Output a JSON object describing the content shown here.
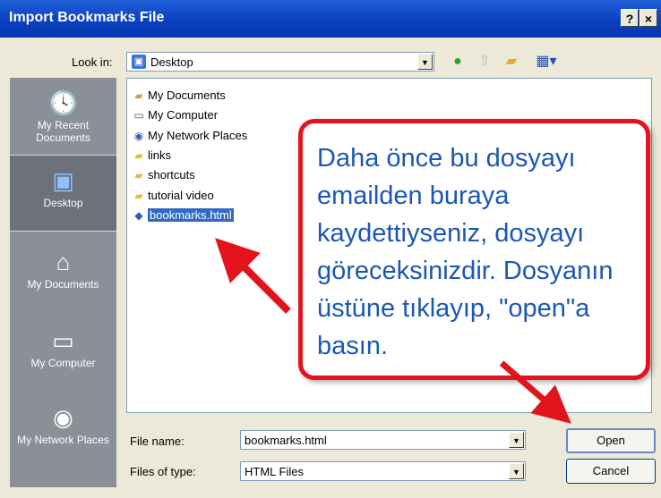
{
  "window": {
    "title": "Import Bookmarks File",
    "help_label": "?",
    "close_label": "×"
  },
  "lookin": {
    "label": "Look in:",
    "value": "Desktop"
  },
  "places": [
    {
      "label": "My Recent Documents",
      "icon": "recent-documents-icon"
    },
    {
      "label": "Desktop",
      "icon": "desktop-icon"
    },
    {
      "label": "My Documents",
      "icon": "my-documents-icon"
    },
    {
      "label": "My Computer",
      "icon": "my-computer-icon"
    },
    {
      "label": "My Network Places",
      "icon": "network-places-icon"
    }
  ],
  "files": [
    {
      "name": "My Documents",
      "icon": "folder-icon"
    },
    {
      "name": "My Computer",
      "icon": "computer-icon"
    },
    {
      "name": "My Network Places",
      "icon": "network-icon"
    },
    {
      "name": "links",
      "icon": "folder-icon"
    },
    {
      "name": "shortcuts",
      "icon": "folder-icon"
    },
    {
      "name": "tutorial video",
      "icon": "folder-icon"
    },
    {
      "name": "bookmarks.html",
      "icon": "html-file-icon",
      "selected": true
    }
  ],
  "callout": {
    "text": "Daha önce bu dosyayı emailden buraya kaydettiyseniz, dosyayı göreceksinizdir. Dosyanın üstüne tıklayıp, \"open\"a basın."
  },
  "filename": {
    "label": "File name:",
    "value": "bookmarks.html"
  },
  "filetype": {
    "label": "Files of type:",
    "value": "HTML Files"
  },
  "buttons": {
    "open": "Open",
    "cancel": "Cancel"
  },
  "colors": {
    "title_bar": "#0a3fbf",
    "callout_border": "#e3131b",
    "callout_text": "#1b57b5",
    "selection": "#316ac5"
  }
}
